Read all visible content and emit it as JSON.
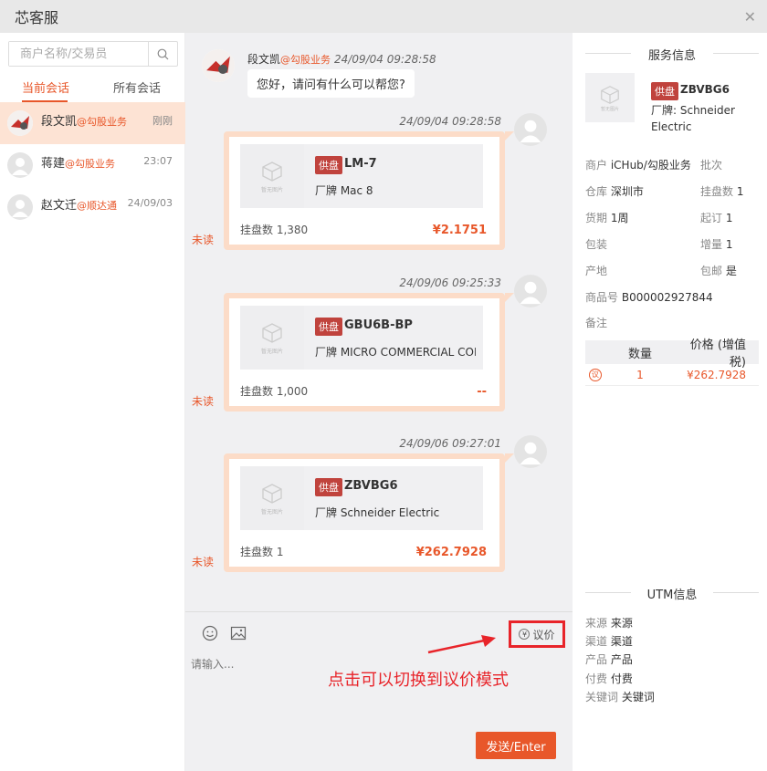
{
  "window": {
    "title": "芯客服"
  },
  "sidebar": {
    "search_placeholder": "商户名称/交易员",
    "tabs": [
      {
        "label": "当前会话"
      },
      {
        "label": "所有会话"
      }
    ],
    "conversations": [
      {
        "name": "段文凯",
        "tag": "@勾股业务",
        "time": "刚刚"
      },
      {
        "name": "蒋建",
        "tag": "@勾股业务",
        "time": "23:07"
      },
      {
        "name": "赵文迁",
        "tag": "@顺达通",
        "time": "24/09/03"
      }
    ]
  },
  "chat": {
    "incoming": {
      "name": "段文凯",
      "tag": "@勾股业务",
      "time": "24/09/04 09:28:58",
      "text": "您好，请问有什么可以帮您?"
    },
    "cards": [
      {
        "time": "24/09/04 09:28:58",
        "badge": "供盘",
        "part": "LM-7",
        "brand": "厂牌 Mac 8",
        "qty": "挂盘数 1,380",
        "price": "¥2.1751",
        "unread": "未读"
      },
      {
        "time": "24/09/06 09:25:33",
        "badge": "供盘",
        "part": "GBU6B-BP",
        "brand": "厂牌 MICRO COMMERCIAL COMPONENTS",
        "qty": "挂盘数 1,000",
        "price": "--",
        "unread": "未读"
      },
      {
        "time": "24/09/06 09:27:01",
        "badge": "供盘",
        "part": "ZBVBG6",
        "brand": "厂牌 Schneider Electric",
        "qty": "挂盘数 1",
        "price": "¥262.7928",
        "unread": "未读"
      }
    ],
    "thumb_caption": "暂无图片"
  },
  "composer": {
    "negotiate_label": "议价",
    "placeholder": "请输入...",
    "send_label": "发送/Enter",
    "annotation": "点击可以切换到议价模式"
  },
  "service_info": {
    "heading": "服务信息",
    "badge": "供盘",
    "part": "ZBVBG6",
    "brand": "厂牌: Schneider Electric",
    "merchant_label": "商户",
    "merchant": "iCHub/勾股业务",
    "batch_label": "批次",
    "warehouse_label": "仓库",
    "warehouse": "深圳市",
    "listed_label": "挂盘数",
    "listed": "1",
    "lead_label": "货期",
    "lead": "1周",
    "moq_label": "起订",
    "moq": "1",
    "package_label": "包装",
    "increment_label": "增量",
    "increment": "1",
    "origin_label": "产地",
    "shipping_label": "包邮",
    "shipping": "是",
    "sku_label": "商品号",
    "sku": "B000002927844",
    "remark_label": "备注",
    "table": {
      "col_qty": "数量",
      "col_price": "价格 (增值税)",
      "row_qty": "1",
      "row_price": "¥262.7928",
      "row_icon": "议"
    }
  },
  "utm_info": {
    "heading": "UTM信息",
    "source_label": "来源",
    "source": "来源",
    "channel_label": "渠道",
    "channel": "渠道",
    "product_label": "产品",
    "product": "产品",
    "paid_label": "付费",
    "paid": "付费",
    "keyword_label": "关键词",
    "keyword": "关键词"
  },
  "colors": {
    "accent": "#e8572a",
    "badge": "#c0433d",
    "highlight": "#e8242a"
  }
}
